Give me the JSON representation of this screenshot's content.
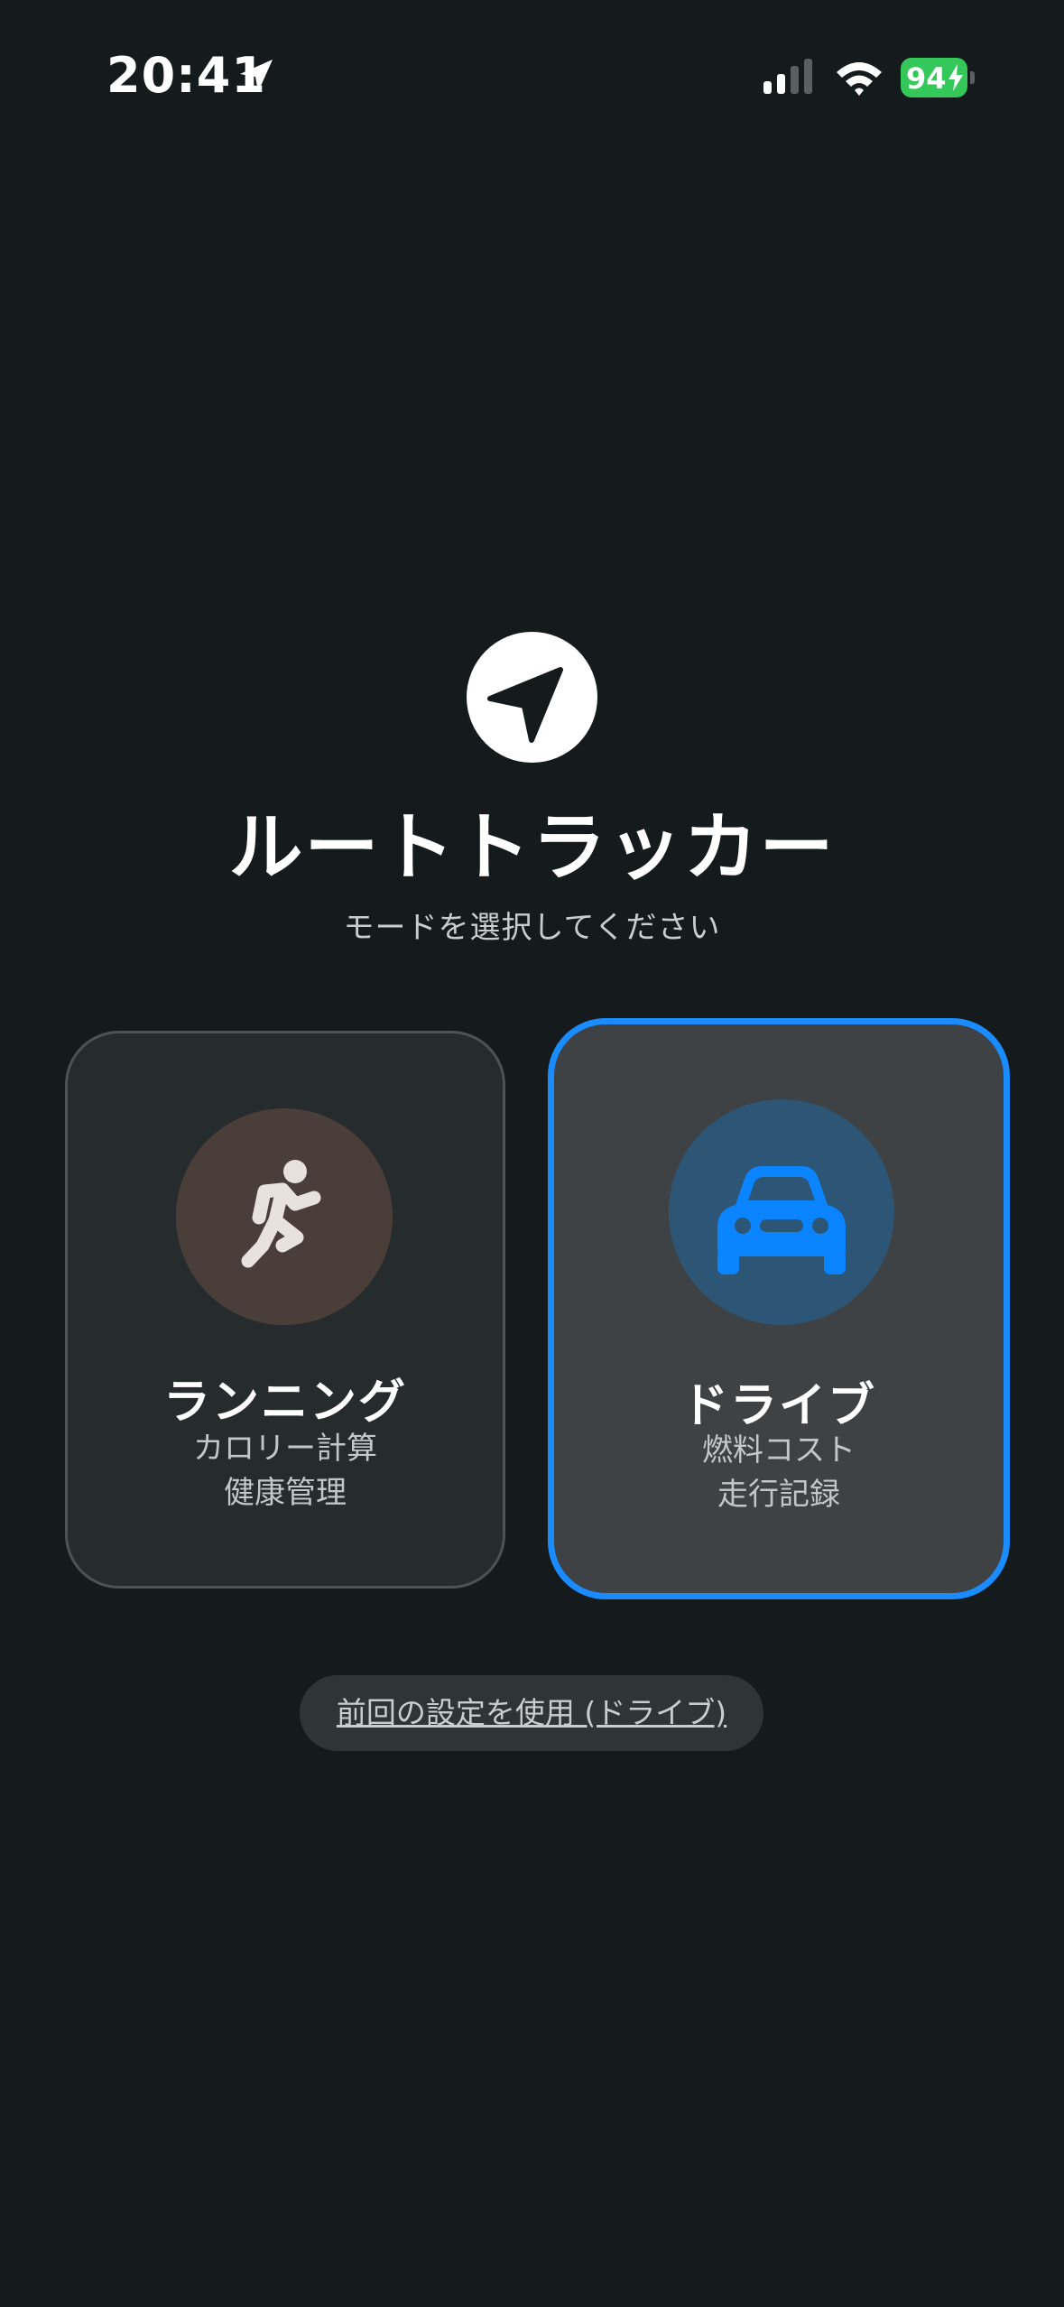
{
  "status_bar": {
    "time": "20:41",
    "battery_level": "94",
    "location_icon": "location-arrow-icon",
    "signal_icon": "cellular-signal-icon",
    "wifi_icon": "wifi-icon",
    "battery_color": "#34c759"
  },
  "header": {
    "logo_icon": "navigation-arrow-icon",
    "title": "ルートトラッカー",
    "subtitle": "モードを選択してください"
  },
  "modes": [
    {
      "id": "running",
      "icon": "running-person-icon",
      "title": "ランニング",
      "line1": "カロリー計算",
      "line2": "健康管理",
      "selected": false,
      "accent": "#4a3f38"
    },
    {
      "id": "drive",
      "icon": "car-icon",
      "title": "ドライブ",
      "line1": "燃料コスト",
      "line2": "走行記録",
      "selected": true,
      "accent": "#1a8cff"
    }
  ],
  "reuse_button": {
    "label": "前回の設定を使用 (ドライブ)"
  }
}
